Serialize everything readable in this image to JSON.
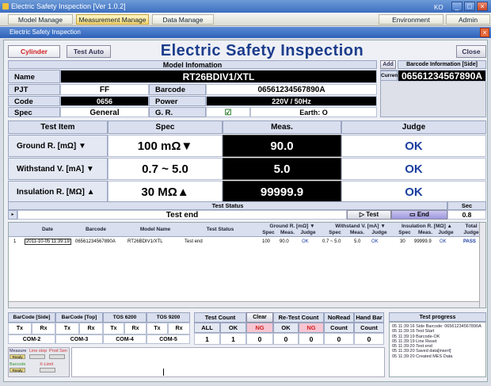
{
  "window": {
    "title": "Electric Safety Inspection [Ver 1.0.2]",
    "tray": "KO"
  },
  "menus": {
    "left": [
      "Model Manage",
      "Measurement Manage",
      "Data Manage"
    ],
    "right": [
      "Environment Manage",
      "Admin Manage"
    ]
  },
  "subwindow": {
    "title": "Electric Safety Inspection"
  },
  "toolbar": {
    "cylinder_manual": "Cylinder Manual",
    "test_auto": "Test Auto",
    "title": "Electric Safety Inspection",
    "close": "Close"
  },
  "model_info": {
    "header": "Model Infomation",
    "name_label": "Name",
    "name_value": "RT26BDIV1/XTL",
    "pjt_label": "PJT",
    "pjt_value": "FF",
    "barcode_label": "Barcode",
    "barcode_value": "06561234567890A",
    "code_label": "Code",
    "code_value": "0656",
    "power_label": "Power",
    "power_value": "220V / 50Hz",
    "spec_label": "Spec",
    "spec_value": "General",
    "gr_label": "G. R.",
    "gr_check": "☑",
    "earth": "Earth: O"
  },
  "barcode_info": {
    "add": "Add",
    "header": "Barcode Information [Side]",
    "current_label": "Current",
    "current_value": "06561234567890A"
  },
  "tests": {
    "headers": {
      "item": "Test Item",
      "spec": "Spec",
      "meas": "Meas.",
      "judge": "Judge"
    },
    "rows": [
      {
        "item": "Ground R.   [mΩ] ▼",
        "spec": "100 mΩ▼",
        "meas": "90.0",
        "judge": "OK"
      },
      {
        "item": "Withstand V.   [mA] ▼",
        "spec": "0.7 ~ 5.0",
        "meas": "5.0",
        "judge": "OK"
      },
      {
        "item": "Insulation R.  [MΩ] ▲",
        "spec": "30 MΩ▲",
        "meas": "99999.9",
        "judge": "OK"
      }
    ]
  },
  "status": {
    "header": "Test Status",
    "sec_label": "Sec",
    "text": "Test end",
    "test_btn": "▷ Test",
    "end_btn": "▭ End",
    "sec_value": "0.8"
  },
  "table": {
    "headers": {
      "date": "Date",
      "barcode": "Barcode",
      "model": "Model Name",
      "status": "Test Status",
      "ground": "Ground R. [mΩ] ▼",
      "withstand": "Withstand V. [mA] ▼",
      "insulation": "Insulation R. [MΩ] ▲",
      "total": "Total",
      "judge": "Judge",
      "spec": "Spec",
      "meas": "Meas."
    },
    "rows": [
      {
        "no": "1",
        "date": "2011-10-05 11:39:19",
        "barcode": "06561234567890A",
        "model": "RT26BDIV1/XTL",
        "status": "Test end",
        "g_spec": "100",
        "g_meas": "90.0",
        "g_judge": "OK",
        "w_spec": "0.7 ~ 5.0",
        "w_meas": "5.0",
        "w_judge": "OK",
        "i_spec": "30",
        "i_meas": "99999.9",
        "i_judge": "OK",
        "total": "PASS"
      }
    ]
  },
  "ports": {
    "headers": [
      "BarCode [Side]",
      "BarCode [Top]",
      "TOS 6200",
      "TOS 9200"
    ],
    "txrx": [
      "Tx",
      "Rx"
    ],
    "coms": [
      "COM-2",
      "COM-3",
      "COM-4",
      "COM-5"
    ]
  },
  "counts": {
    "test_count": "Test Count",
    "clear": "Clear",
    "retest_count": "Re-Test Count",
    "noread": "NoRead",
    "handbar": "Hand Bar",
    "all": "ALL",
    "ok": "OK",
    "ng": "NG",
    "count": "Count",
    "values": {
      "all": "1",
      "ok": "1",
      "ng": "0",
      "rok": "0",
      "rng": "0",
      "noread": "0",
      "handbar": "0"
    }
  },
  "signals": {
    "measure": "Measure",
    "line_stop": "Line stop",
    "prod_sen": "Prod Sen",
    "barcode": "Barcode",
    "x_limit": "X-Limit",
    "ready": "Ready"
  },
  "progress": {
    "header": "Test progress",
    "lines": [
      "05 11:39:16 Side Barcode: 06561234567890A",
      "05 11:39:16 Test Start",
      "05 11:39:19 Barcode-OK",
      "05 11:39:19 Line Reset",
      "05 11:39:20 Test end",
      "05 11:39:20 Saved data[insert]",
      "05 11:39:20 Created MES Data"
    ]
  },
  "colors": {
    "accent": "#1c3d8c",
    "ok": "#1b3fa0",
    "ng": "#d02020"
  }
}
